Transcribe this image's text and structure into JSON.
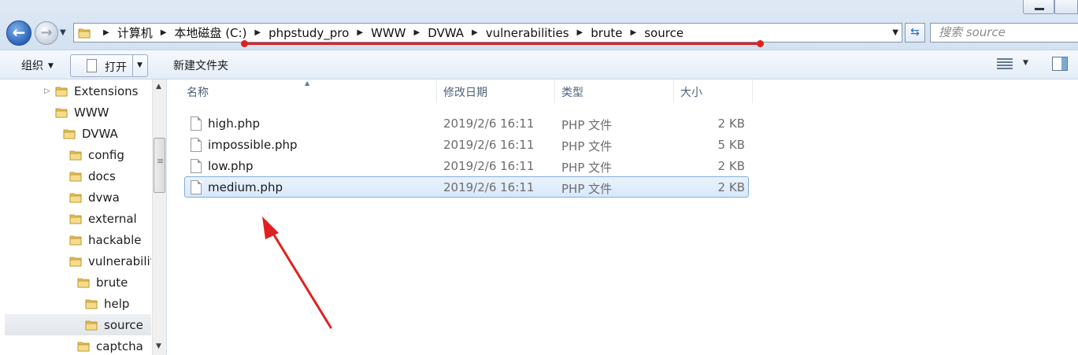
{
  "window": {
    "minimize_icon": "minimize-icon",
    "maximize_icon": "maximize-icon"
  },
  "address_bar": {
    "breadcrumbs": [
      "计算机",
      "本地磁盘 (C:)",
      "phpstudy_pro",
      "WWW",
      "DVWA",
      "vulnerabilities",
      "brute",
      "source"
    ],
    "search_placeholder": "搜索 source"
  },
  "toolbar": {
    "organize_label": "组织",
    "open_label": "打开",
    "new_folder_label": "新建文件夹"
  },
  "nav_tree": [
    {
      "label": "Extensions"
    },
    {
      "label": "WWW"
    },
    {
      "label": "DVWA"
    },
    {
      "label": "config"
    },
    {
      "label": "docs"
    },
    {
      "label": "dvwa"
    },
    {
      "label": "external"
    },
    {
      "label": "hackable"
    },
    {
      "label": "vulnerabiliti"
    },
    {
      "label": "brute"
    },
    {
      "label": "help"
    },
    {
      "label": "source",
      "selected": true
    },
    {
      "label": "captcha"
    }
  ],
  "file_list": {
    "columns": {
      "name": "名称",
      "date": "修改日期",
      "type": "类型",
      "size": "大小"
    },
    "files": [
      {
        "name": "high.php",
        "date": "2019/2/6 16:11",
        "type": "PHP 文件",
        "size": "2 KB"
      },
      {
        "name": "impossible.php",
        "date": "2019/2/6 16:11",
        "type": "PHP 文件",
        "size": "5 KB"
      },
      {
        "name": "low.php",
        "date": "2019/2/6 16:11",
        "type": "PHP 文件",
        "size": "2 KB"
      },
      {
        "name": "medium.php",
        "date": "2019/2/6 16:11",
        "type": "PHP 文件",
        "size": "2 KB",
        "selected": true
      }
    ]
  },
  "colors": {
    "annotation_red": "#e02020",
    "selection_border": "#84acdd",
    "folder_yellow": "#f3d16b"
  }
}
